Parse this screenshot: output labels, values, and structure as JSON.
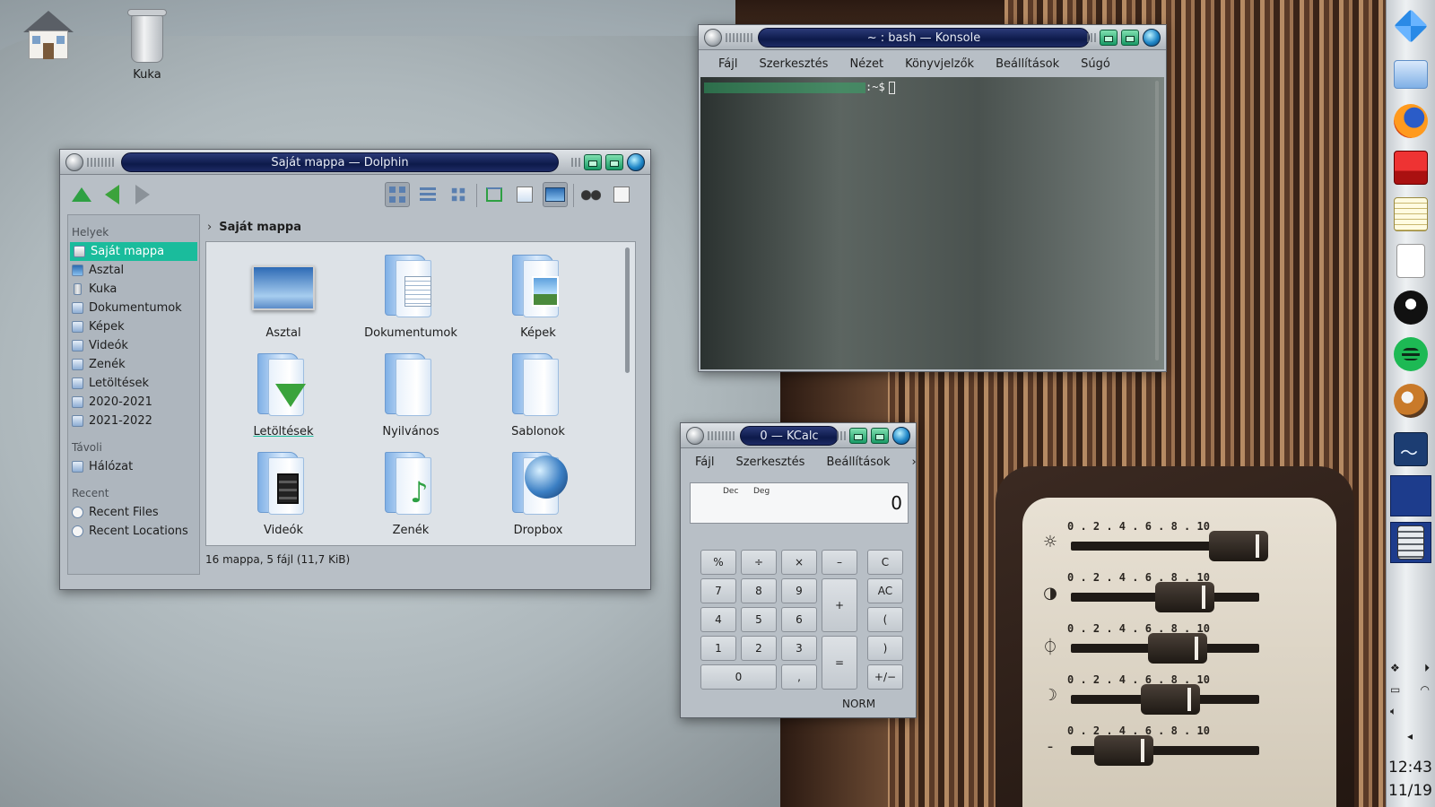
{
  "desktop": {
    "icons": [
      {
        "label": ""
      },
      {
        "label": "Kuka"
      }
    ]
  },
  "dolphin": {
    "title": "Saját mappa — Dolphin",
    "places": {
      "sections": [
        "Helyek",
        "Távoli",
        "Recent"
      ],
      "helyek": [
        "Saját mappa",
        "Asztal",
        "Kuka",
        "Dokumentumok",
        "Képek",
        "Videók",
        "Zenék",
        "Letöltések",
        "2020-2021",
        "2021-2022"
      ],
      "tavoli": [
        "Hálózat"
      ],
      "recent": [
        "Recent Files",
        "Recent Locations"
      ]
    },
    "breadcrumb": "Saját mappa",
    "files": [
      "Asztal",
      "Dokumentumok",
      "Képek",
      "Letöltések",
      "Nyilvános",
      "Sablonok",
      "Videók",
      "Zenék",
      "Dropbox"
    ],
    "status": "16 mappa, 5 fájl (11,7 KiB)"
  },
  "konsole": {
    "title": "~ : bash — Konsole",
    "menu": [
      "Fájl",
      "Szerkesztés",
      "Nézet",
      "Könyvjelzők",
      "Beállítások",
      "Súgó"
    ],
    "prompt_suffix": ":~$"
  },
  "kcalc": {
    "title": "0 — KCalc",
    "menu": [
      "Fájl",
      "Szerkesztés",
      "Beállítások"
    ],
    "more": "›",
    "tags": [
      "Dec",
      "Deg"
    ],
    "display": "0",
    "buttons": {
      "percent": "%",
      "div": "÷",
      "mul": "×",
      "minus": "–",
      "clear": "C",
      "n7": "7",
      "n8": "8",
      "n9": "9",
      "plus": "+",
      "allclear": "AC",
      "n4": "4",
      "n5": "5",
      "n6": "6",
      "lparen": "(",
      "n1": "1",
      "n2": "2",
      "n3": "3",
      "equals": "=",
      "rparen": ")",
      "n0": "0",
      "comma": ",",
      "plusminus": "+/−"
    },
    "mode": "NORM"
  },
  "dock": {
    "items": [
      "dropbox-icon",
      "folder-icon",
      "firefox-icon",
      "dictionary-icon",
      "notepad-icon",
      "blank-document-icon",
      "inkscape-icon",
      "spotify-icon",
      "gimp-icon",
      "system-monitor-icon",
      "terminal-icon",
      "calculator-icon"
    ],
    "terminal_glyph": ">_",
    "clock_time": "12:43",
    "clock_date": "11/19"
  },
  "wallpaper": {
    "scale": "0 . 2 . 4 . 6 . 8 . 10"
  }
}
